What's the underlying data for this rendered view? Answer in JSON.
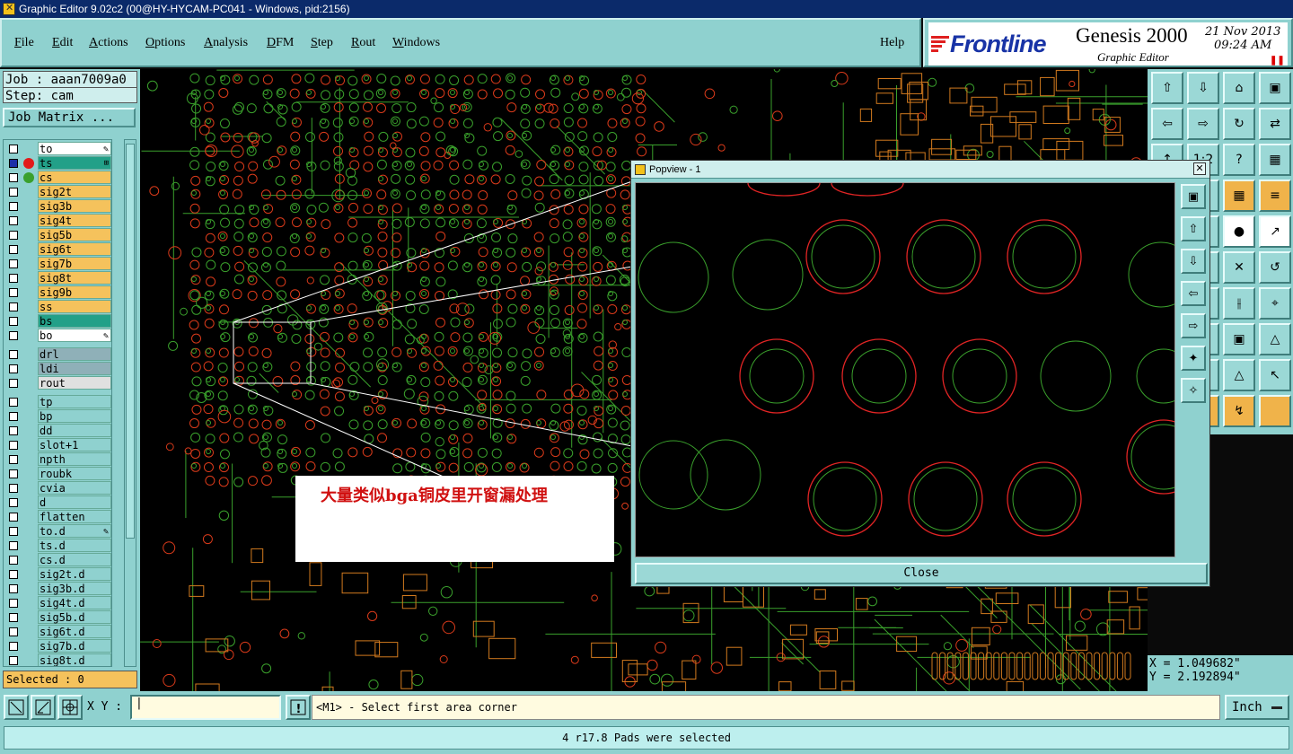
{
  "window": {
    "title": "Graphic Editor 9.02c2 (00@HY-HYCAM-PC041 - Windows, pid:2156)"
  },
  "menu": {
    "items": [
      "File",
      "Edit",
      "Actions",
      "Options",
      "Analysis",
      "DFM",
      "Step",
      "Rout",
      "Windows"
    ],
    "help": "Help"
  },
  "logo": {
    "brand": "Frontline",
    "product": "Genesis 2000",
    "subtitle": "Graphic Editor",
    "date": "21 Nov 2013",
    "time": "09:24 AM"
  },
  "job": {
    "job_label": "Job : aaan7009a0",
    "step_label": "Step: cam",
    "matrix_button": "Job Matrix ..."
  },
  "layers": [
    {
      "name": "to",
      "color": "#ffffff",
      "mark": "pencil"
    },
    {
      "name": "ts",
      "color": "#22a088",
      "dot": "#e21a1a",
      "active": true,
      "mark": "grid"
    },
    {
      "name": "cs",
      "color": "#f5c25c",
      "dot": "#3aa02c"
    },
    {
      "name": "sig2t",
      "color": "#f5c25c"
    },
    {
      "name": "sig3b",
      "color": "#f5c25c"
    },
    {
      "name": "sig4t",
      "color": "#f5c25c"
    },
    {
      "name": "sig5b",
      "color": "#f5c25c"
    },
    {
      "name": "sig6t",
      "color": "#f5c25c"
    },
    {
      "name": "sig7b",
      "color": "#f5c25c"
    },
    {
      "name": "sig8t",
      "color": "#f5c25c"
    },
    {
      "name": "sig9b",
      "color": "#f5c25c"
    },
    {
      "name": "ss",
      "color": "#f5c25c"
    },
    {
      "name": "bs",
      "color": "#22a088"
    },
    {
      "name": "bo",
      "color": "#ffffff",
      "mark": "pencil"
    },
    {
      "name": "drl",
      "color": "#8fb0b8",
      "gap": true
    },
    {
      "name": "ldi",
      "color": "#8fb0b8"
    },
    {
      "name": "rout",
      "color": "#e0e0e0"
    },
    {
      "name": "tp",
      "color": "#8fd1cf",
      "gap": true
    },
    {
      "name": "bp",
      "color": "#8fd1cf"
    },
    {
      "name": "dd",
      "color": "#8fd1cf"
    },
    {
      "name": "slot+1",
      "color": "#8fd1cf"
    },
    {
      "name": "npth",
      "color": "#8fd1cf"
    },
    {
      "name": "roubk",
      "color": "#8fd1cf"
    },
    {
      "name": "cvia",
      "color": "#8fd1cf"
    },
    {
      "name": "d",
      "color": "#8fd1cf"
    },
    {
      "name": "flatten",
      "color": "#8fd1cf"
    },
    {
      "name": "to.d",
      "color": "#8fd1cf",
      "mark": "pencil"
    },
    {
      "name": "ts.d",
      "color": "#8fd1cf"
    },
    {
      "name": "cs.d",
      "color": "#8fd1cf"
    },
    {
      "name": "sig2t.d",
      "color": "#8fd1cf"
    },
    {
      "name": "sig3b.d",
      "color": "#8fd1cf"
    },
    {
      "name": "sig4t.d",
      "color": "#8fd1cf"
    },
    {
      "name": "sig5b.d",
      "color": "#8fd1cf"
    },
    {
      "name": "sig6t.d",
      "color": "#8fd1cf"
    },
    {
      "name": "sig7b.d",
      "color": "#8fd1cf"
    },
    {
      "name": "sig8t.d",
      "color": "#8fd1cf"
    }
  ],
  "selected_label": "Selected : 0",
  "annotation": "大量类似bga铜皮里开窗漏处理",
  "popview": {
    "title": "Popview - 1",
    "close_label": "Close"
  },
  "coords": {
    "x": "X = 1.049682\"",
    "y": "Y = 2.192894\""
  },
  "bottom": {
    "xy_label": "X Y :",
    "prompt": "<M1> - Select first area corner",
    "unit": "Inch"
  },
  "status": "4 r17.8 Pads were selected",
  "colors": {
    "panel": "#8fd1cf",
    "copper_green": "#3aa02c",
    "pad_red": "#d93a1a",
    "orange_pad": "#d27a1e"
  }
}
